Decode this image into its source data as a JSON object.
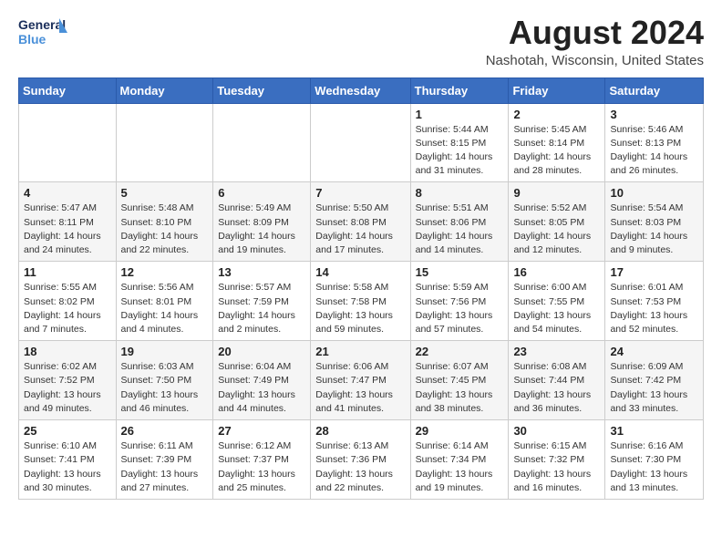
{
  "header": {
    "logo_general": "General",
    "logo_blue": "Blue",
    "month_year": "August 2024",
    "location": "Nashotah, Wisconsin, United States"
  },
  "days_of_week": [
    "Sunday",
    "Monday",
    "Tuesday",
    "Wednesday",
    "Thursday",
    "Friday",
    "Saturday"
  ],
  "weeks": [
    [
      {
        "day": "",
        "info": ""
      },
      {
        "day": "",
        "info": ""
      },
      {
        "day": "",
        "info": ""
      },
      {
        "day": "",
        "info": ""
      },
      {
        "day": "1",
        "info": "Sunrise: 5:44 AM\nSunset: 8:15 PM\nDaylight: 14 hours\nand 31 minutes."
      },
      {
        "day": "2",
        "info": "Sunrise: 5:45 AM\nSunset: 8:14 PM\nDaylight: 14 hours\nand 28 minutes."
      },
      {
        "day": "3",
        "info": "Sunrise: 5:46 AM\nSunset: 8:13 PM\nDaylight: 14 hours\nand 26 minutes."
      }
    ],
    [
      {
        "day": "4",
        "info": "Sunrise: 5:47 AM\nSunset: 8:11 PM\nDaylight: 14 hours\nand 24 minutes."
      },
      {
        "day": "5",
        "info": "Sunrise: 5:48 AM\nSunset: 8:10 PM\nDaylight: 14 hours\nand 22 minutes."
      },
      {
        "day": "6",
        "info": "Sunrise: 5:49 AM\nSunset: 8:09 PM\nDaylight: 14 hours\nand 19 minutes."
      },
      {
        "day": "7",
        "info": "Sunrise: 5:50 AM\nSunset: 8:08 PM\nDaylight: 14 hours\nand 17 minutes."
      },
      {
        "day": "8",
        "info": "Sunrise: 5:51 AM\nSunset: 8:06 PM\nDaylight: 14 hours\nand 14 minutes."
      },
      {
        "day": "9",
        "info": "Sunrise: 5:52 AM\nSunset: 8:05 PM\nDaylight: 14 hours\nand 12 minutes."
      },
      {
        "day": "10",
        "info": "Sunrise: 5:54 AM\nSunset: 8:03 PM\nDaylight: 14 hours\nand 9 minutes."
      }
    ],
    [
      {
        "day": "11",
        "info": "Sunrise: 5:55 AM\nSunset: 8:02 PM\nDaylight: 14 hours\nand 7 minutes."
      },
      {
        "day": "12",
        "info": "Sunrise: 5:56 AM\nSunset: 8:01 PM\nDaylight: 14 hours\nand 4 minutes."
      },
      {
        "day": "13",
        "info": "Sunrise: 5:57 AM\nSunset: 7:59 PM\nDaylight: 14 hours\nand 2 minutes."
      },
      {
        "day": "14",
        "info": "Sunrise: 5:58 AM\nSunset: 7:58 PM\nDaylight: 13 hours\nand 59 minutes."
      },
      {
        "day": "15",
        "info": "Sunrise: 5:59 AM\nSunset: 7:56 PM\nDaylight: 13 hours\nand 57 minutes."
      },
      {
        "day": "16",
        "info": "Sunrise: 6:00 AM\nSunset: 7:55 PM\nDaylight: 13 hours\nand 54 minutes."
      },
      {
        "day": "17",
        "info": "Sunrise: 6:01 AM\nSunset: 7:53 PM\nDaylight: 13 hours\nand 52 minutes."
      }
    ],
    [
      {
        "day": "18",
        "info": "Sunrise: 6:02 AM\nSunset: 7:52 PM\nDaylight: 13 hours\nand 49 minutes."
      },
      {
        "day": "19",
        "info": "Sunrise: 6:03 AM\nSunset: 7:50 PM\nDaylight: 13 hours\nand 46 minutes."
      },
      {
        "day": "20",
        "info": "Sunrise: 6:04 AM\nSunset: 7:49 PM\nDaylight: 13 hours\nand 44 minutes."
      },
      {
        "day": "21",
        "info": "Sunrise: 6:06 AM\nSunset: 7:47 PM\nDaylight: 13 hours\nand 41 minutes."
      },
      {
        "day": "22",
        "info": "Sunrise: 6:07 AM\nSunset: 7:45 PM\nDaylight: 13 hours\nand 38 minutes."
      },
      {
        "day": "23",
        "info": "Sunrise: 6:08 AM\nSunset: 7:44 PM\nDaylight: 13 hours\nand 36 minutes."
      },
      {
        "day": "24",
        "info": "Sunrise: 6:09 AM\nSunset: 7:42 PM\nDaylight: 13 hours\nand 33 minutes."
      }
    ],
    [
      {
        "day": "25",
        "info": "Sunrise: 6:10 AM\nSunset: 7:41 PM\nDaylight: 13 hours\nand 30 minutes."
      },
      {
        "day": "26",
        "info": "Sunrise: 6:11 AM\nSunset: 7:39 PM\nDaylight: 13 hours\nand 27 minutes."
      },
      {
        "day": "27",
        "info": "Sunrise: 6:12 AM\nSunset: 7:37 PM\nDaylight: 13 hours\nand 25 minutes."
      },
      {
        "day": "28",
        "info": "Sunrise: 6:13 AM\nSunset: 7:36 PM\nDaylight: 13 hours\nand 22 minutes."
      },
      {
        "day": "29",
        "info": "Sunrise: 6:14 AM\nSunset: 7:34 PM\nDaylight: 13 hours\nand 19 minutes."
      },
      {
        "day": "30",
        "info": "Sunrise: 6:15 AM\nSunset: 7:32 PM\nDaylight: 13 hours\nand 16 minutes."
      },
      {
        "day": "31",
        "info": "Sunrise: 6:16 AM\nSunset: 7:30 PM\nDaylight: 13 hours\nand 13 minutes."
      }
    ]
  ]
}
